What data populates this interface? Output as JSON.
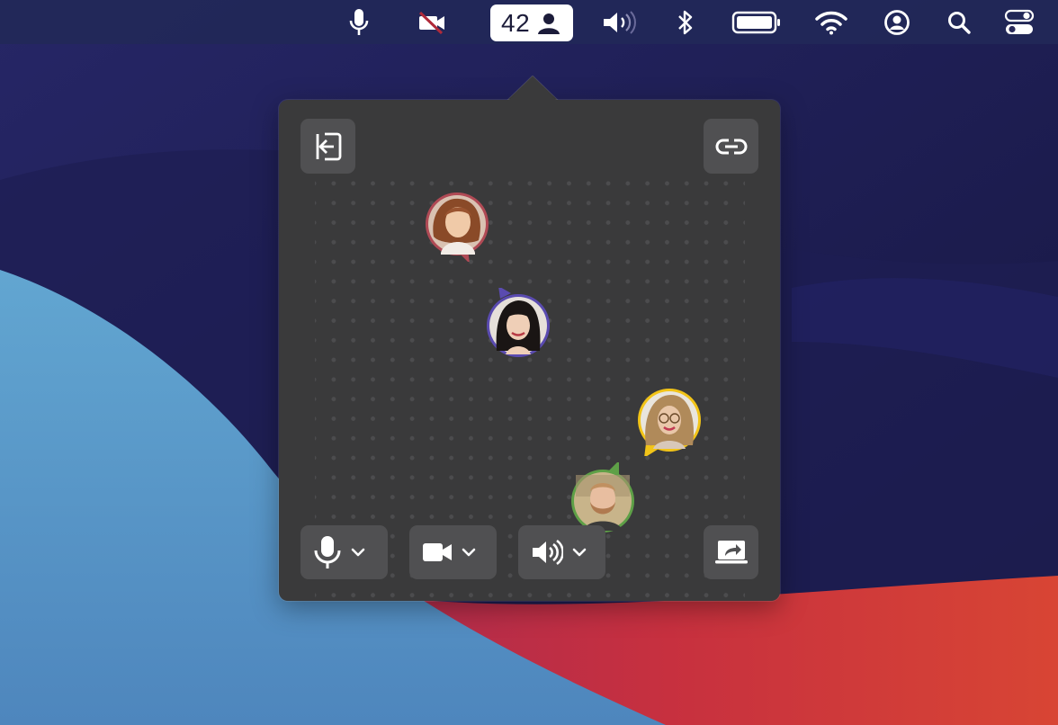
{
  "menubar": {
    "participant_count": "42",
    "icons": [
      "microphone-icon",
      "video-off-icon",
      "person-icon",
      "speaker-icon",
      "bluetooth-icon",
      "battery-icon",
      "wifi-icon",
      "user-circle-icon",
      "search-icon",
      "control-center-icon"
    ]
  },
  "popover": {
    "top_buttons": [
      "leave-icon",
      "link-icon"
    ],
    "participants": [
      {
        "name": "participant-red-ring",
        "ring": "#b04a55"
      },
      {
        "name": "participant-purple-ring",
        "ring": "#5a4bb0"
      },
      {
        "name": "participant-yellow-ring",
        "ring": "#f2c418"
      },
      {
        "name": "participant-green-ring",
        "ring": "#5ea047"
      }
    ],
    "controls": [
      "microphone-icon",
      "video-camera-icon",
      "speaker-icon",
      "screen-share-icon"
    ]
  },
  "colors": {
    "panel": "#3a3a3b",
    "button": "#505052",
    "wallpaper_blue": "#5a9ac7",
    "wallpaper_red": "#c73a45",
    "wallpaper_navy": "#1c1c4a"
  }
}
